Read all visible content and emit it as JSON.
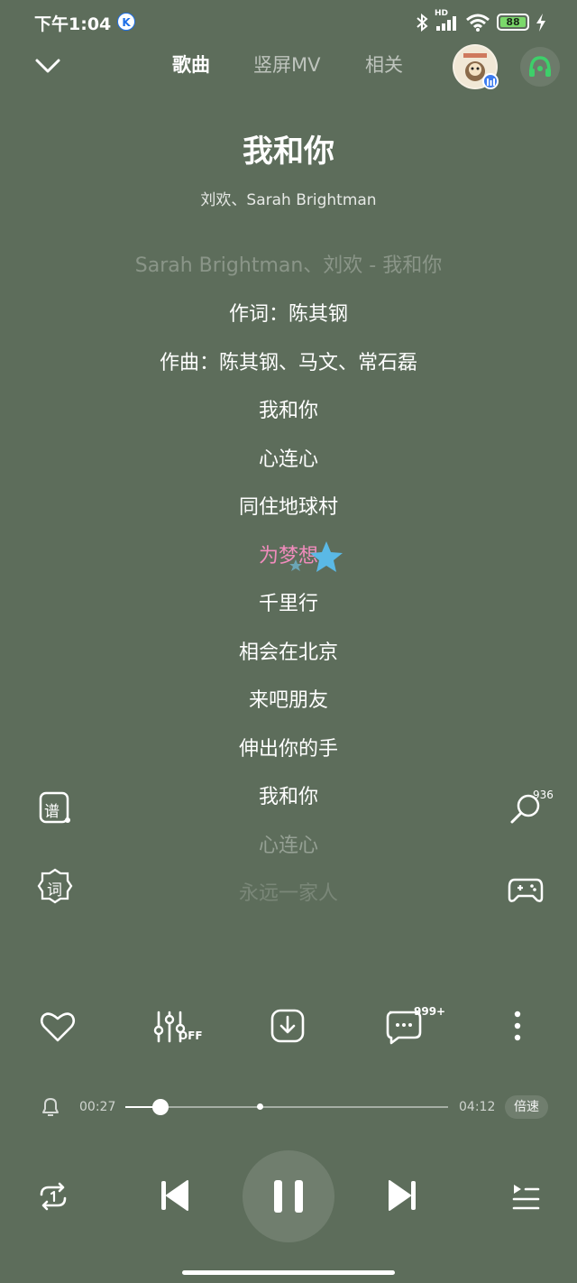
{
  "status_bar": {
    "time": "下午1:04",
    "k_badge": "K",
    "network": "HD",
    "battery": "88"
  },
  "header": {
    "tabs": [
      {
        "label": "歌曲",
        "active": true
      },
      {
        "label": "竖屏MV",
        "active": false
      },
      {
        "label": "相关",
        "active": false
      }
    ]
  },
  "song": {
    "title": "我和你",
    "artists": "刘欢、Sarah Brightman"
  },
  "lyrics": {
    "lines": [
      "Sarah Brightman、刘欢 - 我和你",
      "作词：陈其钢",
      "作曲：陈其钢、马文、常石磊",
      "我和你",
      "心连心",
      "同住地球村",
      "为梦想",
      "千里行",
      "相会在北京",
      "来吧朋友",
      "伸出你的手",
      "我和你",
      "心连心",
      "永远一家人"
    ],
    "current_index": 6
  },
  "side_buttons": {
    "score_label": "谱",
    "lyric_label": "词",
    "listen_count": "936"
  },
  "actions": {
    "eq_state": "OFF",
    "comment_count": "999+"
  },
  "progress": {
    "elapsed": "00:27",
    "total": "04:12",
    "fraction": 0.11,
    "speed_label": "倍速"
  },
  "colors": {
    "background": "#5d6d5b",
    "active_lyric": "#f08cbc",
    "accent_green": "#3ecf6a"
  }
}
